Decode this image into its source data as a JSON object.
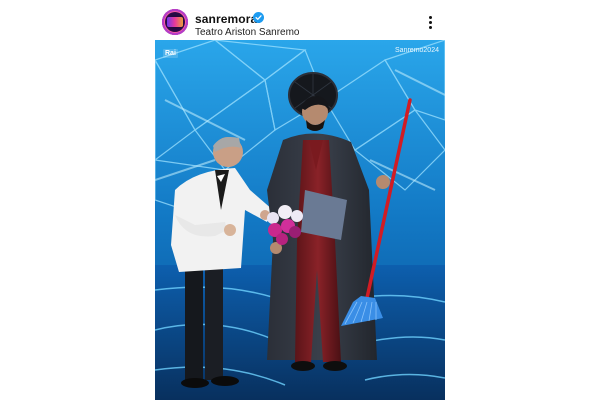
{
  "post": {
    "account_name": "sanremorai",
    "location": "Teatro Ariston Sanremo",
    "verified": true,
    "avatar_icon": "sanremo-logo-avatar",
    "more_icon": "more-options-icon"
  },
  "photo": {
    "watermark_broadcaster": "Rai",
    "watermark_event": "Sanremo2024"
  },
  "colors": {
    "verified_blue": "#1d9bf0",
    "stage_blue": "#1a8fd8"
  }
}
